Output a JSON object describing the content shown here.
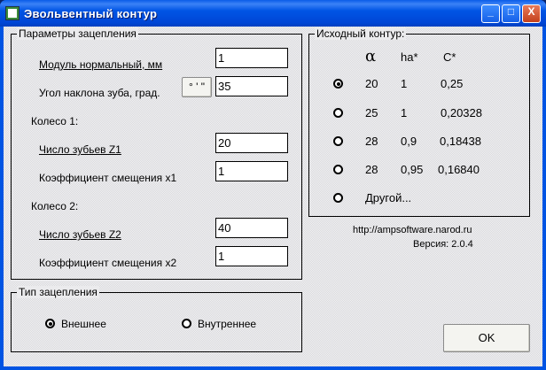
{
  "window": {
    "title": "Эвольвентный  контур",
    "minimize": "_",
    "maximize": "□",
    "close": "X"
  },
  "params": {
    "legend": "Параметры зацепления",
    "module_label": "Модуль нормальный, мм",
    "module_value": "1",
    "angle_label": "Угол наклона зуба, град.",
    "angle_button": "° ' \"",
    "angle_value": "35",
    "wheel1": "Колесо 1:",
    "z1_label": "Число зубьев Z1",
    "z1_value": "20",
    "x1_label": "Коэффициент смещения x1",
    "x1_value": "1",
    "wheel2": "Колесо 2:",
    "z2_label": "Число зубьев Z2",
    "z2_value": "40",
    "x2_label": "Коэффициент смещения x2",
    "x2_value": "1"
  },
  "mesh": {
    "legend": "Тип зацепления",
    "external": "Внешнее",
    "internal": "Внутреннее",
    "selected": "external"
  },
  "contour": {
    "legend": "Исходный контур:",
    "headers": [
      "α",
      "ha*",
      "C*"
    ],
    "rows": [
      [
        "20",
        "1",
        "0,25"
      ],
      [
        "25",
        "1",
        "0,20328"
      ],
      [
        "28",
        "0,9",
        "0,18438"
      ],
      [
        "28",
        "0,95",
        "0,16840"
      ]
    ],
    "other": "Другой...",
    "selected_index": 0
  },
  "url": "http://ampsoftware.narod.ru",
  "version": "Версия: 2.0.4",
  "ok": "OK"
}
